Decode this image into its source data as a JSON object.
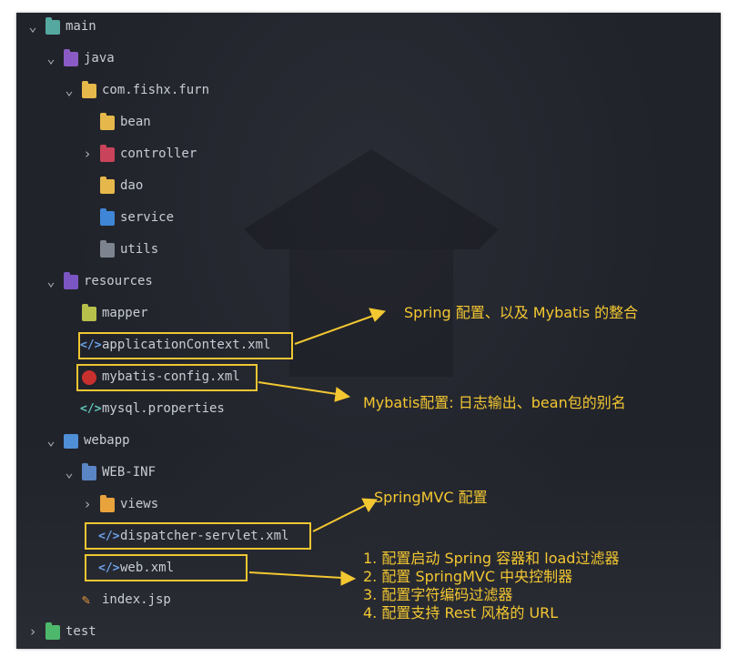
{
  "tree": {
    "items": [
      {
        "label": "main",
        "icon": "module-folder-icon"
      },
      {
        "label": "java",
        "icon": "java-source-folder-icon"
      },
      {
        "label": "com.fishx.furn",
        "icon": "package-folder-icon"
      },
      {
        "label": "bean",
        "icon": "folder-icon"
      },
      {
        "label": "controller",
        "icon": "controller-folder-icon"
      },
      {
        "label": "dao",
        "icon": "folder-icon"
      },
      {
        "label": "service",
        "icon": "service-folder-icon"
      },
      {
        "label": "utils",
        "icon": "utils-folder-icon"
      },
      {
        "label": "resources",
        "icon": "resources-folder-icon"
      },
      {
        "label": "mapper",
        "icon": "mapper-folder-icon"
      },
      {
        "label": "applicationContext.xml",
        "icon": "xml-file-icon"
      },
      {
        "label": "mybatis-config.xml",
        "icon": "mybatis-file-icon"
      },
      {
        "label": "mysql.properties",
        "icon": "properties-file-icon"
      },
      {
        "label": "webapp",
        "icon": "webapp-folder-icon"
      },
      {
        "label": "WEB-INF",
        "icon": "web-inf-folder-icon"
      },
      {
        "label": "views",
        "icon": "views-folder-icon"
      },
      {
        "label": "dispatcher-servlet.xml",
        "icon": "xml-file-icon"
      },
      {
        "label": "web.xml",
        "icon": "xml-file-icon"
      },
      {
        "label": "index.jsp",
        "icon": "jsp-file-icon"
      },
      {
        "label": "test",
        "icon": "test-folder-icon"
      }
    ]
  },
  "annotations": {
    "spring": "Spring 配置、以及 Mybatis 的整合",
    "mybatis": "Mybatis配置: 日志输出、bean包的别名",
    "springmvc": "SpringMVC 配置",
    "web_lines": [
      "1. 配置启动 Spring 容器和 load过滤器",
      "2. 配置 SpringMVC 中央控制器",
      "3. 配置字符编码过滤器",
      "4. 配置支持 Rest 风格的 URL"
    ]
  },
  "colors": {
    "highlight": "#f0c632",
    "text": "#c8ccd4",
    "background": "#21232b"
  }
}
